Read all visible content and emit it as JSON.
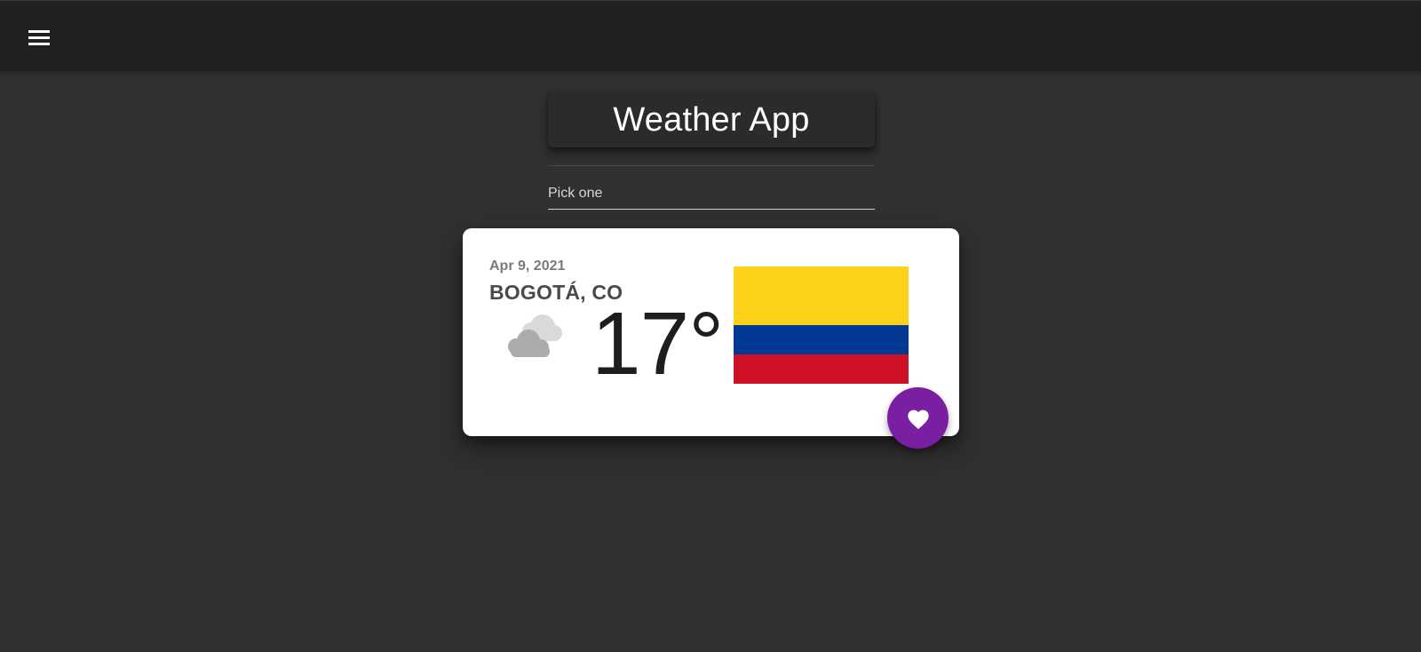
{
  "app_bar": {
    "menu_icon": "menu-icon"
  },
  "title_card": {
    "title": "Weather App"
  },
  "city_select": {
    "placeholder": "Pick one"
  },
  "weather_card": {
    "date": "Apr 9, 2021",
    "city": "BOGOTÁ, CO",
    "temperature": "17°",
    "condition_icon": "cloudy-icon",
    "flag_icon": "colombia-flag-icon",
    "flag_colors": [
      "#fed21b",
      "#003893",
      "#ce1126"
    ]
  },
  "favorite_button": {
    "icon": "heart-icon",
    "color": "#7b1fa2"
  },
  "colors": {
    "background": "#303030",
    "app_bar": "#212121",
    "card": "#ffffff"
  }
}
